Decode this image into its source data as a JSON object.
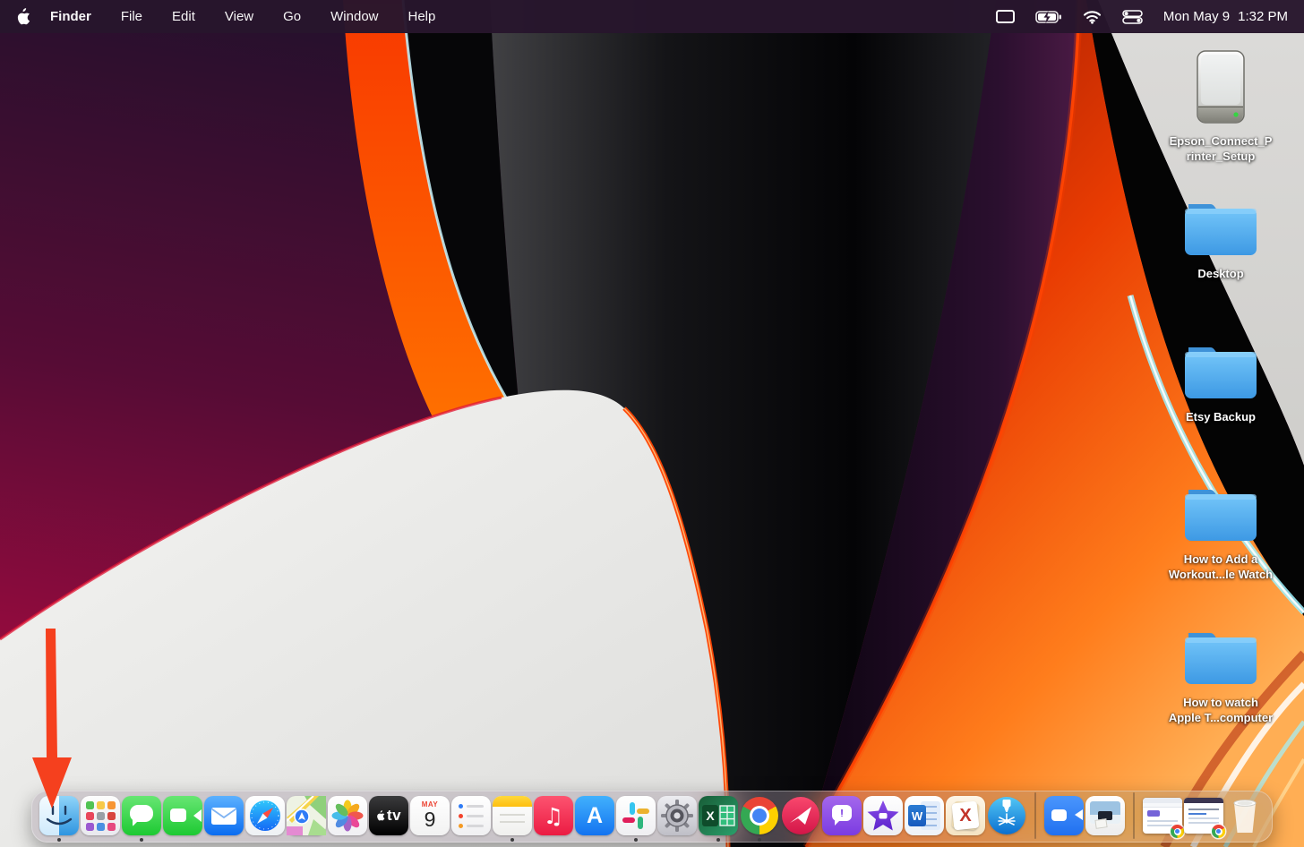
{
  "menu_bar": {
    "menus": [
      "Finder",
      "File",
      "Edit",
      "View",
      "Go",
      "Window",
      "Help"
    ],
    "status_icons": [
      "display-mirroring",
      "battery-charging",
      "wifi",
      "control-center"
    ],
    "clock": {
      "date": "Mon May 9",
      "time": "1:32 PM"
    }
  },
  "desktop": {
    "icons": [
      {
        "kind": "external-drive",
        "line1": "Epson_Connect_P",
        "line2": "rinter_Setup"
      },
      {
        "kind": "folder",
        "line1": "Desktop",
        "line2": ""
      },
      {
        "kind": "folder",
        "line1": "Etsy Backup",
        "line2": ""
      },
      {
        "kind": "folder",
        "line1": "How to Add a",
        "line2": "Workout...le Watch"
      },
      {
        "kind": "folder",
        "line1": "How to watch",
        "line2": "Apple T...computer"
      }
    ]
  },
  "dock": {
    "items": [
      {
        "label": "Finder",
        "running": true
      },
      {
        "label": "Launchpad",
        "running": false
      },
      {
        "label": "Messages",
        "running": true
      },
      {
        "label": "FaceTime",
        "running": false
      },
      {
        "label": "Mail",
        "running": false
      },
      {
        "label": "Safari",
        "running": false
      },
      {
        "label": "Maps",
        "running": false
      },
      {
        "label": "Photos",
        "running": false
      },
      {
        "label": "Apple TV",
        "running": false
      },
      {
        "label": "Calendar",
        "running": false
      },
      {
        "label": "Reminders",
        "running": false
      },
      {
        "label": "Notes",
        "running": true
      },
      {
        "label": "Music",
        "running": false
      },
      {
        "label": "App Store",
        "running": false
      },
      {
        "label": "Slack",
        "running": true
      },
      {
        "label": "System Preferences",
        "running": false
      },
      {
        "label": "Microsoft Excel",
        "running": true
      },
      {
        "label": "Google Chrome",
        "running": true
      },
      {
        "label": "Skitch",
        "running": false
      },
      {
        "label": "Feedback Assistant",
        "running": false
      },
      {
        "label": "iMovie",
        "running": false
      },
      {
        "label": "Microsoft Word",
        "running": false
      },
      {
        "label": "xTool",
        "running": false
      },
      {
        "label": "LightBurn",
        "running": false
      },
      {
        "label": "Zoom",
        "running": false
      },
      {
        "label": "Image Capture",
        "running": false
      },
      {
        "label": "Chrome window 1",
        "running": false
      },
      {
        "label": "Chrome window 2",
        "running": false
      },
      {
        "label": "Trash",
        "running": false
      }
    ],
    "glyphs": {
      "apple_tv": "tv",
      "calendar_month": "MAY",
      "calendar_day": "9",
      "app_store": "A",
      "excel": "X",
      "word": "W",
      "xtool": "X",
      "feedback": "!"
    }
  },
  "annotation": {
    "type": "arrow",
    "color": "#f5401e"
  }
}
